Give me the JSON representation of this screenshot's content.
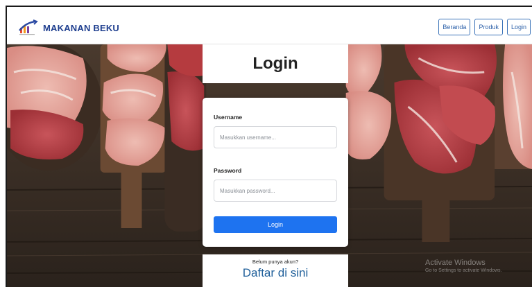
{
  "navbar": {
    "brand_name": "MAKANAN BEKU",
    "logo_icon": "chart-logo-icon",
    "links": [
      {
        "label": "Beranda"
      },
      {
        "label": "Produk"
      },
      {
        "label": "Login"
      }
    ],
    "link_color": "#2a5fa8"
  },
  "login": {
    "title": "Login",
    "username_label": "Username",
    "username_placeholder": "Masukkan username...",
    "username_value": "",
    "password_label": "Password",
    "password_placeholder": "Masukkan password...",
    "password_value": "",
    "submit_label": "Login",
    "submit_color": "#1e73f0"
  },
  "register": {
    "question": "Belum punya akun?",
    "link_label": "Daftar di sini"
  },
  "watermark": {
    "title": "Activate Windows",
    "subtitle": "Go to Settings to activate Windows."
  }
}
